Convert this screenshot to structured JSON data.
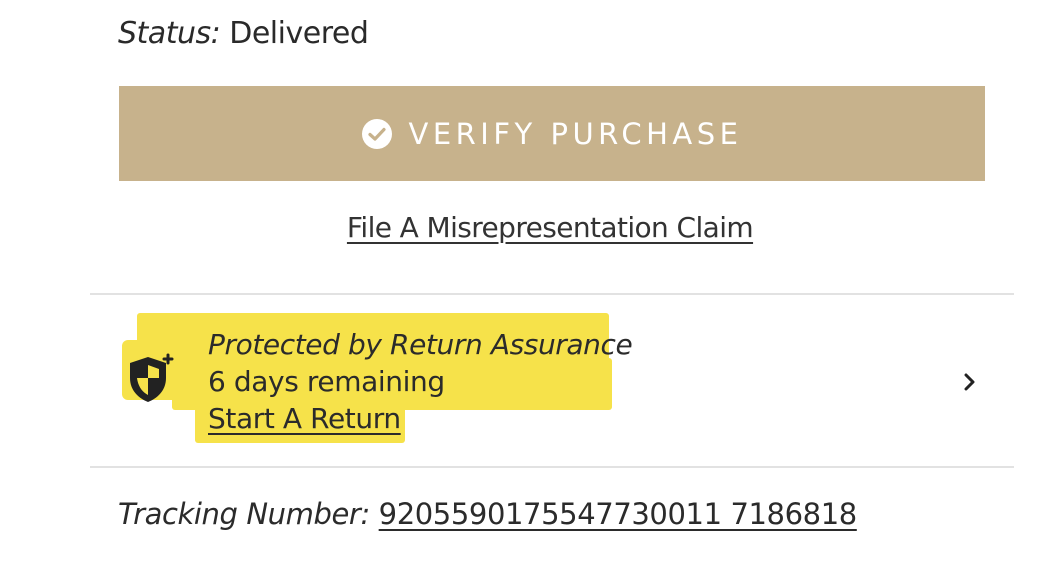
{
  "order": {
    "status_label": "Status:",
    "status_value": "Delivered"
  },
  "verify": {
    "label": "VERIFY PURCHASE",
    "icon": "check-circle-icon",
    "bg_color": "#c7b28c"
  },
  "claim": {
    "label": "File A Misrepresentation Claim"
  },
  "protection": {
    "icon": "shield-icon",
    "title": "Protected by Return Assurance",
    "remaining": "6 days remaining",
    "start_return_label": "Start A Return",
    "highlight_color": "#f6e24a"
  },
  "tracking": {
    "label": "Tracking Number:",
    "number": "9205590175547730011 7186818"
  }
}
